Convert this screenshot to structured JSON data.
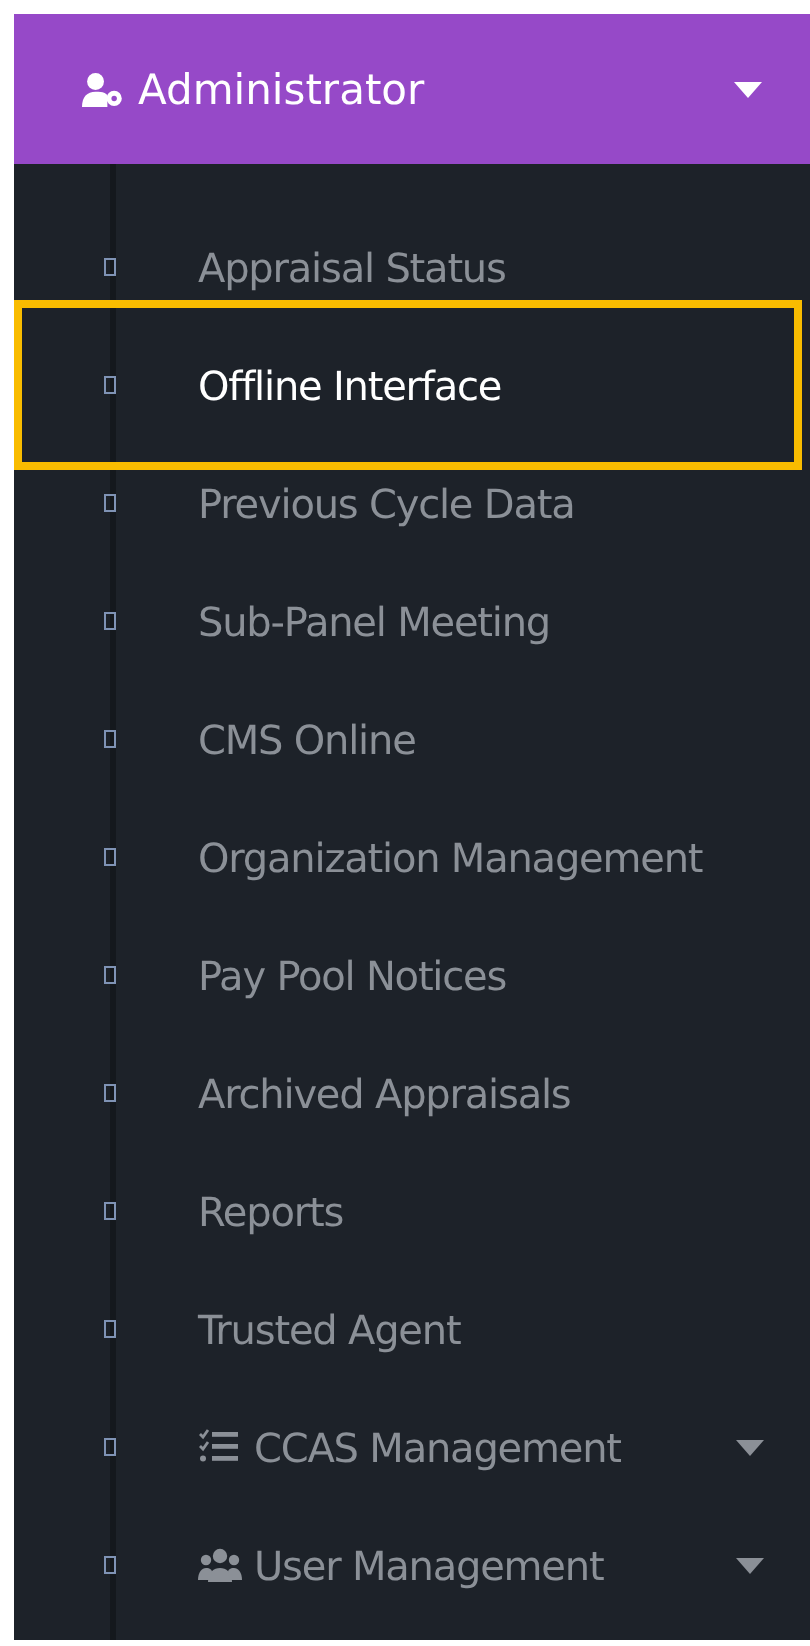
{
  "header": {
    "title": "Administrator",
    "expanded": true
  },
  "items": [
    {
      "kind": "link",
      "label": "Appraisal Status",
      "selected": false
    },
    {
      "kind": "link",
      "label": "Offline Interface",
      "selected": true
    },
    {
      "kind": "link",
      "label": "Previous Cycle Data",
      "selected": false
    },
    {
      "kind": "link",
      "label": "Sub-Panel Meeting",
      "selected": false
    },
    {
      "kind": "link",
      "label": "CMS Online",
      "selected": false
    },
    {
      "kind": "link",
      "label": "Organization Management",
      "selected": false
    },
    {
      "kind": "link",
      "label": "Pay Pool Notices",
      "selected": false
    },
    {
      "kind": "link",
      "label": "Archived Appraisals",
      "selected": false
    },
    {
      "kind": "link",
      "label": "Reports",
      "selected": false
    },
    {
      "kind": "link",
      "label": "Trusted Agent",
      "selected": false
    },
    {
      "kind": "submenu",
      "label": "CCAS Management",
      "selected": false,
      "expanded": false
    },
    {
      "kind": "submenu",
      "label": "User Management",
      "selected": false,
      "expanded": false
    }
  ]
}
